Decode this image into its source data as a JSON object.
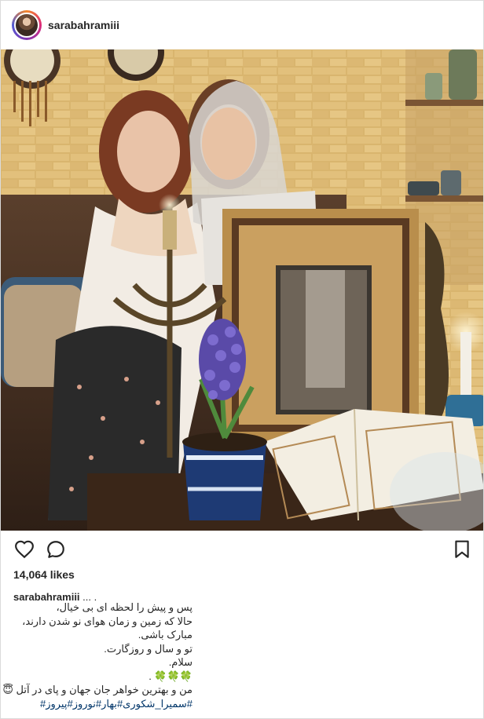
{
  "post": {
    "username": "sarabahramiii",
    "likes": "14,064 likes",
    "caption_user": "sarabahramiii",
    "caption_user_suffix": " ... .",
    "caption_lines": [
      "پس و پیش را لحظه ای بی خیال،",
      "حالا که زمین و زمان هوای نو شدن دارند،",
      "مبارک باشی.",
      "تو و سال و روزگارت.",
      "سلام.",
      "🍀🍀🍀 .",
      "من و بهترین خواهر جان جهان و پای در آتل 😇"
    ],
    "hashtags": "#سمیرا_شکوری#بهار#نوروز#پیروز#"
  },
  "icons": {
    "avatar": "profile-avatar",
    "like": "heart-icon",
    "comment": "comment-bubble-icon",
    "save": "bookmark-icon"
  },
  "colors": {
    "text": "#262626",
    "border": "#dbdbdb",
    "hashtag": "#003569"
  }
}
